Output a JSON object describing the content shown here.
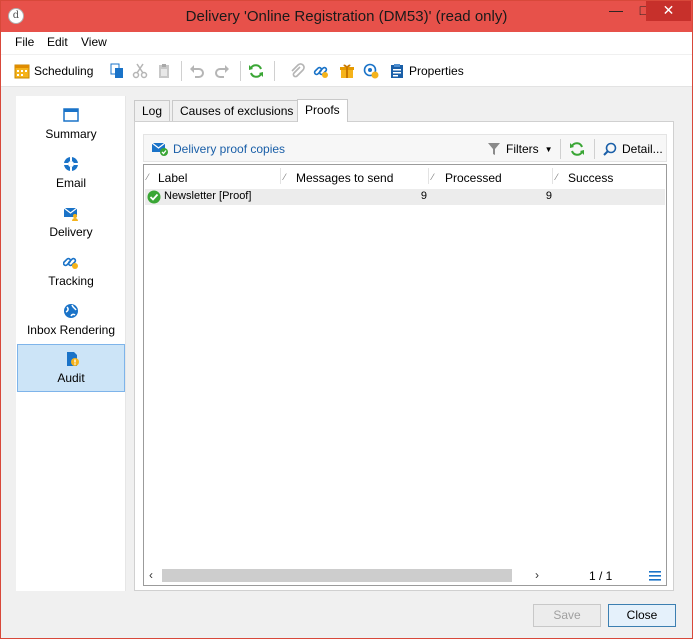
{
  "window": {
    "title": "Delivery 'Online Registration (DM53)' (read only)",
    "app_icon_glyph": "d",
    "controls": {
      "minimize": "—",
      "maximize": "□",
      "close": "✕"
    }
  },
  "menu": [
    "File",
    "Edit",
    "View"
  ],
  "toolbar": {
    "scheduling": "Scheduling",
    "properties": "Properties",
    "icons": [
      "calendar-icon",
      "copy-icon",
      "cut-icon",
      "paste-icon",
      "undo-icon",
      "redo-icon",
      "refresh-icon",
      "attach-icon",
      "link-icon",
      "gift-icon",
      "target-icon",
      "clipboard-icon"
    ]
  },
  "sidebar": {
    "items": [
      {
        "label": "Summary",
        "icon": "window-icon"
      },
      {
        "label": "Email",
        "icon": "lifebuoy-icon"
      },
      {
        "label": "Delivery",
        "icon": "envelope-person-icon"
      },
      {
        "label": "Tracking",
        "icon": "chain-link-icon"
      },
      {
        "label": "Inbox Rendering",
        "icon": "globe-icon"
      },
      {
        "label": "Audit",
        "icon": "audit-icon"
      }
    ],
    "active": "Audit"
  },
  "tabs": [
    "Log",
    "Causes of exclusions",
    "Proofs"
  ],
  "active_tab": "Proofs",
  "subbar": {
    "title": "Delivery proof copies",
    "filters": "Filters",
    "detail": "Detail..."
  },
  "grid": {
    "columns": [
      "Label",
      "Messages to send",
      "Processed",
      "Success"
    ],
    "rows": [
      {
        "label": "Newsletter [Proof]",
        "messages_to_send": "9",
        "processed": "9",
        "success": ""
      }
    ],
    "pager": "1 / 1"
  },
  "buttons": {
    "save": "Save",
    "close": "Close"
  },
  "colors": {
    "titlebar": "#e7514a",
    "accent": "#1a73c8",
    "selection": "#cce4f7",
    "success": "#3aa635"
  }
}
